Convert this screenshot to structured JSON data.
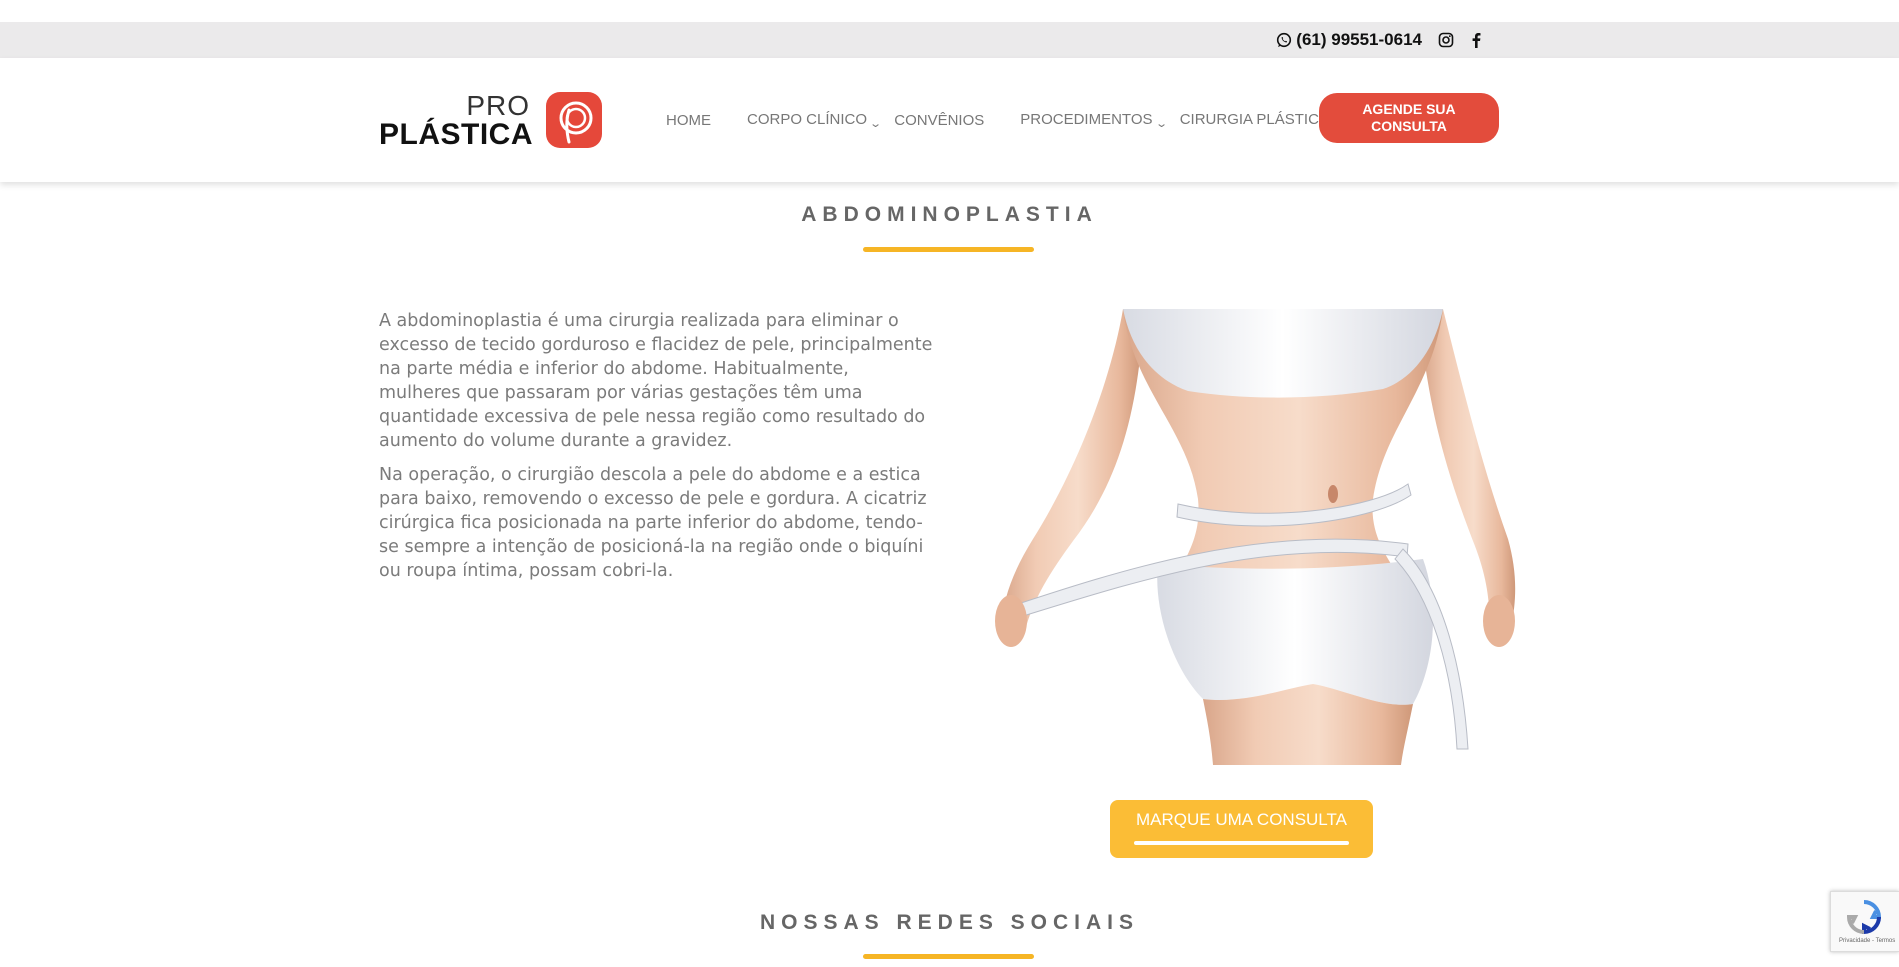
{
  "topbar": {
    "phone": "(61) 99551-0614"
  },
  "logo": {
    "pro": "PRO",
    "plastica": "PLÁSTICA"
  },
  "nav": {
    "items": [
      {
        "label": "HOME"
      },
      {
        "label": "CORPO CLÍNICO"
      },
      {
        "label": "CONVÊNIOS"
      },
      {
        "label": "PROCEDIMENTOS"
      },
      {
        "label": "CIRURGIA PLÁSTICA"
      }
    ],
    "cta_line1": "AGENDE SUA",
    "cta_line2": "CONSULTA"
  },
  "main": {
    "title": "ABDOMINOPLASTIA",
    "paragraphs": [
      "A abdominoplastia é uma cirurgia realizada para eliminar o excesso de tecido gorduroso e flacidez de pele, principalmente na parte média e inferior do abdome. Habitualmente, mulheres que passaram por várias gestações têm uma quantidade excessiva de pele nessa região como resultado do aumento do volume durante a gravidez.",
      "Na operação, o cirurgião descola a pele do abdome e a estica para baixo, removendo o excesso de pele e gordura. A cicatriz cirúrgica fica posicionada na parte inferior do abdome, tendo-se sempre a intenção de posicioná-la na região onde o biquíni ou roupa íntima, possam cobri-la."
    ],
    "cta": "MARQUE UMA CONSULTA"
  },
  "social": {
    "title": "NOSSAS REDES SOCIAIS"
  },
  "recaptcha": {
    "text": "Privacidade - Termos"
  },
  "colors": {
    "accent_red": "#e34c3c",
    "accent_yellow": "#fbbd36",
    "topbar_bg": "#ebeaeb"
  },
  "icons": [
    "whatsapp-icon",
    "instagram-icon",
    "facebook-icon",
    "chevron-down-icon",
    "recaptcha-icon"
  ]
}
